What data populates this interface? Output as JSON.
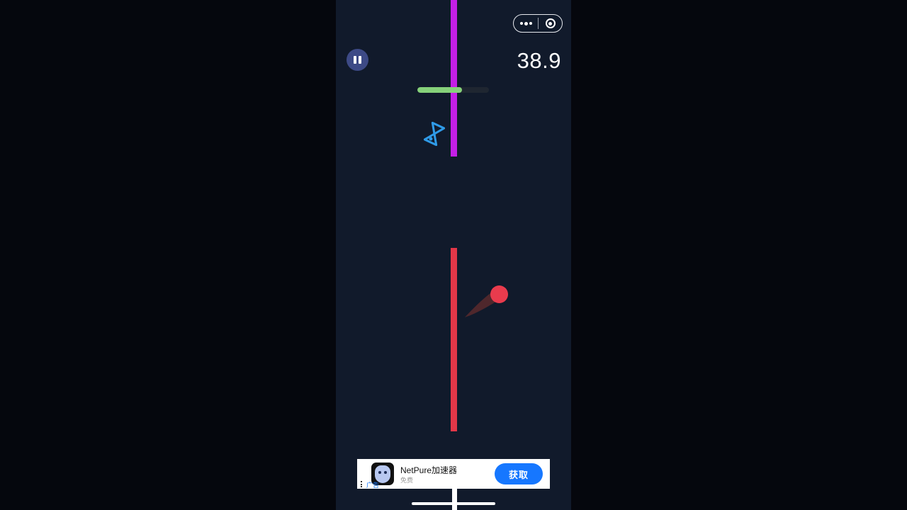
{
  "game": {
    "score": "38.9",
    "progress_fraction": 0.62
  },
  "menu_capsule": {
    "more_icon": "more-dots-icon",
    "close_icon": "target-close-icon"
  },
  "pause_icon": "pause-icon",
  "powerup_icon": "hourglass-icon",
  "ad": {
    "app_name": "NetPure加速器",
    "subtitle": "免费",
    "button_label": "获取",
    "tag": "广告"
  },
  "colors": {
    "background": "#111a2b",
    "top_wall": "#c41fe6",
    "bottom_wall": "#e33748",
    "ball": "#e93b4d",
    "progress": "#86d17a",
    "pause_button": "#3d4a86",
    "ad_button": "#1677ff"
  }
}
